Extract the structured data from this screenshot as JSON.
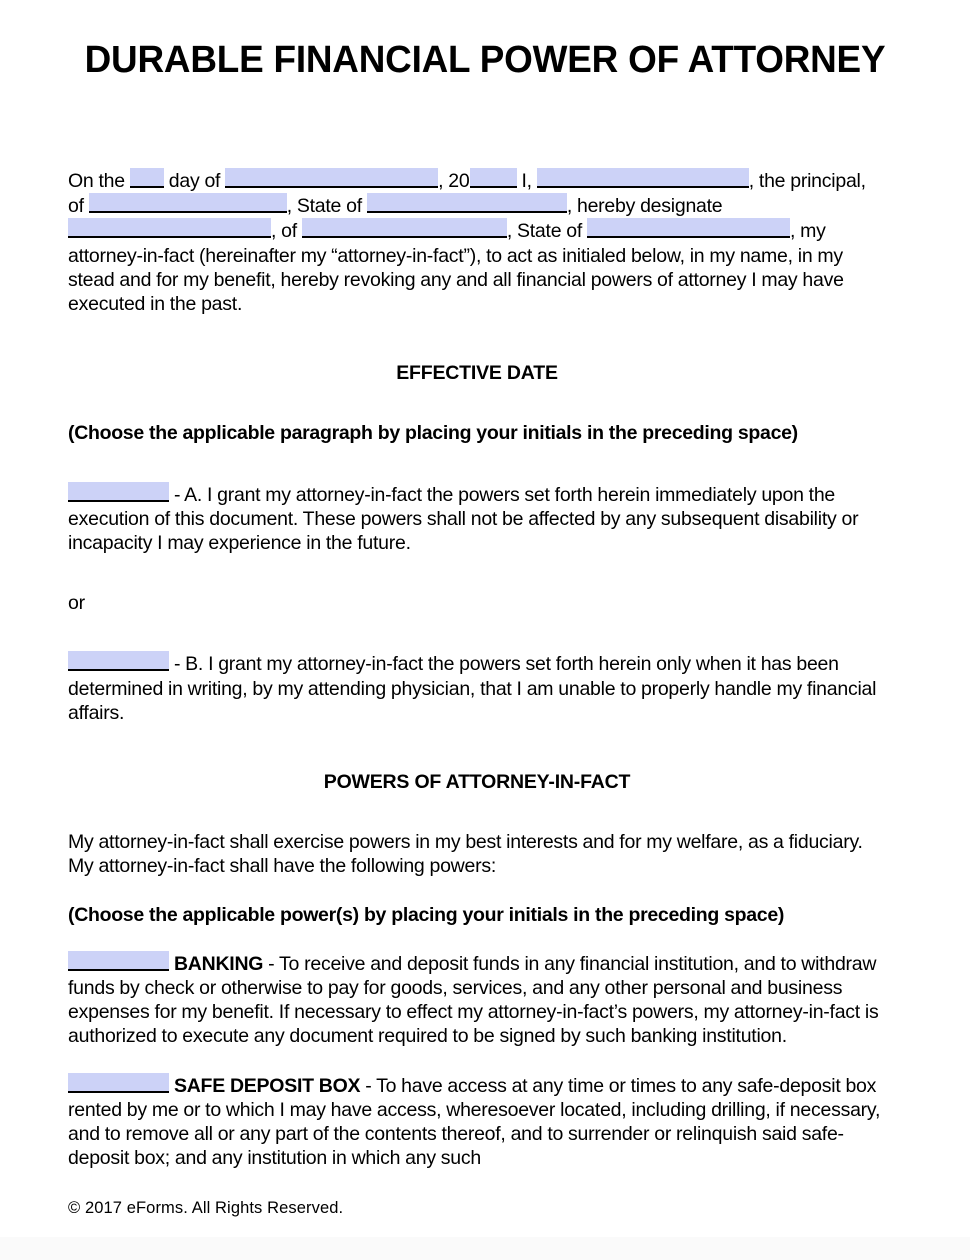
{
  "document": {
    "title": "DURABLE FINANCIAL POWER OF ATTORNEY",
    "footer": "© 2017 eForms. All Rights Reserved.",
    "fill_color": "#ccd2f7",
    "rule_color": "#000000",
    "page_background": "#ffffff"
  },
  "intro": {
    "t1": "On the",
    "t2": "day of",
    "t3": ", 20",
    "t4": "I,",
    "t5": ", the",
    "t6": "principal, of",
    "t7": ", State of",
    "t8": ", hereby designate",
    "t9": ", of",
    "t10": ", State of",
    "t11": ", my",
    "t12": "attorney-in-fact (hereinafter my “attorney-in-fact”), to act as initialed below, in my name, in my stead and for my benefit, hereby revoking any and all financial powers of attorney I may have executed in the past.",
    "fields": {
      "day": "",
      "month": "",
      "year": "",
      "principal_name": "",
      "principal_city": "",
      "principal_state": "",
      "aif_name": "",
      "aif_city": "",
      "aif_state": ""
    }
  },
  "effective_date": {
    "heading": "EFFECTIVE DATE",
    "instruction": "(Choose the applicable paragraph by placing your initials in the preceding space)",
    "option_a": {
      "initials": "",
      "text": " - A. I grant my attorney-in-fact the powers set forth herein immediately upon the execution of this document. These powers shall not be affected by any subsequent disability or incapacity I may experience in the future."
    },
    "or_label": "or",
    "option_b": {
      "initials": "",
      "text": " - B. I grant my attorney-in-fact the powers set forth herein only when it has been determined in writing, by my attending physician, that I am unable to properly handle my financial affairs."
    }
  },
  "powers": {
    "heading": "POWERS OF ATTORNEY-IN-FACT",
    "preamble": "My attorney-in-fact shall exercise powers in my best interests and for my welfare, as a fiduciary. My attorney-in-fact shall have the following powers:",
    "instruction": "(Choose the applicable power(s) by placing your initials in the preceding space)",
    "items": [
      {
        "initials": "",
        "label": "BANKING",
        "separator": " - ",
        "text": "To receive and deposit funds in any financial institution, and to withdraw funds by check or otherwise to pay for goods, services, and any other personal and business expenses for my benefit.  If necessary to effect my attorney-in-fact’s powers, my attorney-in-fact is authorized to execute any document required to be signed by such banking institution."
      },
      {
        "initials": "",
        "label": "SAFE DEPOSIT BOX",
        "separator": " - ",
        "text": "To have access at any time or times to any safe-deposit box rented by me or to which I may have access, wheresoever located, including drilling, if necessary, and to remove all or any part of the contents thereof, and to surrender or relinquish said safe-deposit box; and any institution in which any such"
      }
    ]
  }
}
